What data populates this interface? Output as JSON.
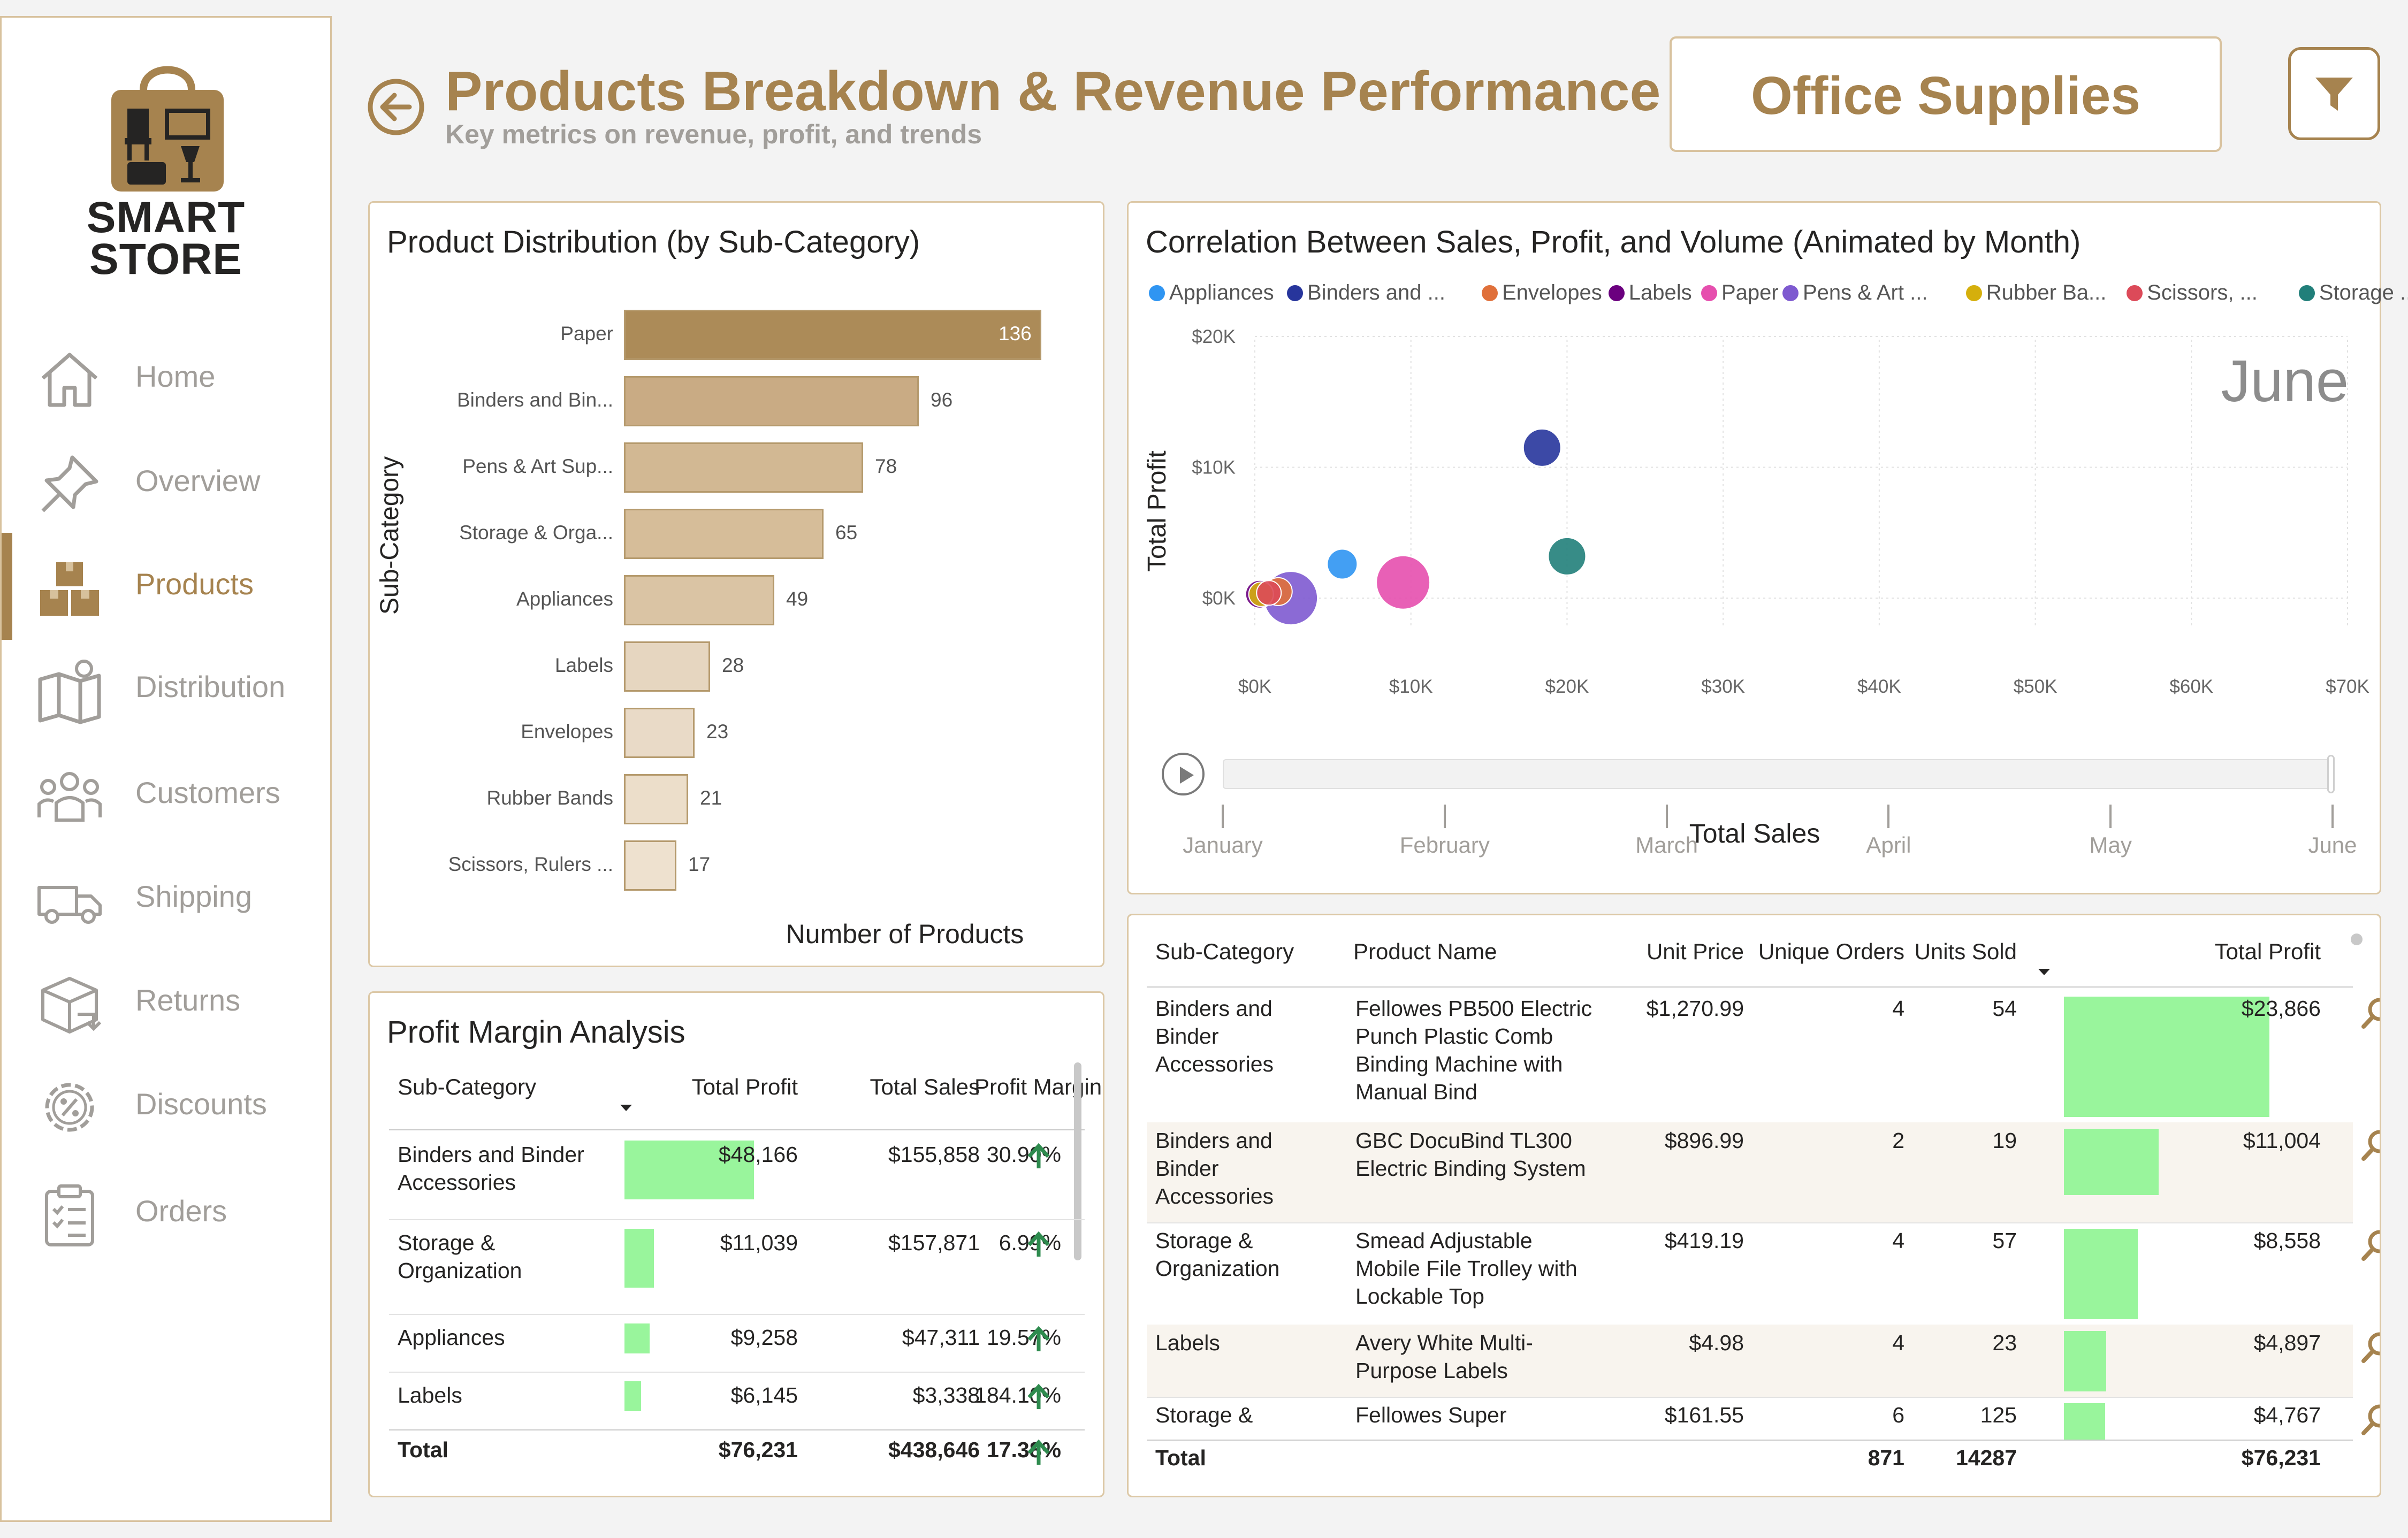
{
  "colors": {
    "accent": "#a6834f",
    "muted": "#a19e9a",
    "positive_bar": "#99f59c",
    "up_arrow": "#2e8b4e"
  },
  "sidebar": {
    "logo_lines": [
      "SMART",
      "STORE"
    ],
    "items": [
      {
        "label": "Home",
        "icon": "home-icon"
      },
      {
        "label": "Overview",
        "icon": "pin-icon"
      },
      {
        "label": "Products",
        "icon": "boxes-icon",
        "active": true
      },
      {
        "label": "Distribution",
        "icon": "map-icon"
      },
      {
        "label": "Customers",
        "icon": "people-icon"
      },
      {
        "label": "Shipping",
        "icon": "truck-icon"
      },
      {
        "label": "Returns",
        "icon": "return-box-icon"
      },
      {
        "label": "Discounts",
        "icon": "discount-gear-icon"
      },
      {
        "label": "Orders",
        "icon": "clipboard-icon"
      }
    ]
  },
  "header": {
    "title": "Products Breakdown & Revenue Performance",
    "subtitle": "Key metrics on revenue, profit, and trends",
    "category": "Office Supplies"
  },
  "product_distribution": {
    "title": "Product Distribution (by Sub-Category)",
    "ylabel": "Sub-Category",
    "xlabel": "Number of Products"
  },
  "chart_data": [
    {
      "type": "bar",
      "orientation": "horizontal",
      "title": "Product Distribution (by Sub-Category)",
      "xlabel": "Number of Products",
      "ylabel": "Sub-Category",
      "categories": [
        "Paper",
        "Binders and Bin...",
        "Pens & Art Sup...",
        "Storage & Orga...",
        "Appliances",
        "Labels",
        "Envelopes",
        "Rubber Bands",
        "Scissors, Rulers ..."
      ],
      "values": [
        136,
        96,
        78,
        65,
        49,
        28,
        23,
        21,
        17
      ],
      "colors": [
        "#ac8b58",
        "#c9ab84",
        "#d2b893",
        "#d6bd99",
        "#dac4a4",
        "#e6d6c0",
        "#e9dac7",
        "#ecdeca",
        "#eee1cf"
      ],
      "data_labels": true
    },
    {
      "type": "scatter",
      "title": "Correlation Between Sales, Profit, and Volume (Animated by Month)",
      "xlabel": "Total Sales",
      "ylabel": "Total Profit",
      "frame_label": "June",
      "x_ticks": [
        "$0K",
        "$10K",
        "$20K",
        "$30K",
        "$40K",
        "$50K",
        "$60K",
        "$70K"
      ],
      "y_ticks": [
        "$20K",
        "$10K",
        "$0K"
      ],
      "xlim": [
        0,
        70000
      ],
      "ylim": [
        -2000,
        20000
      ],
      "grid": true,
      "legend_position": "top",
      "series": [
        {
          "name": "Appliances",
          "color": "#2f95f2",
          "points": [
            {
              "x": 5600,
              "y": 2600,
              "size": 1
            }
          ]
        },
        {
          "name": "Binders and ...",
          "color": "#27359c",
          "points": [
            {
              "x": 18400,
              "y": 11500,
              "size": 1.3
            }
          ]
        },
        {
          "name": "Envelopes",
          "color": "#e0703a",
          "points": [
            {
              "x": 1500,
              "y": 500,
              "size": 0.9
            }
          ]
        },
        {
          "name": "Labels",
          "color": "#6b007f",
          "points": [
            {
              "x": 300,
              "y": 300,
              "size": 0.9
            }
          ]
        },
        {
          "name": "Paper",
          "color": "#e64fae",
          "points": [
            {
              "x": 9500,
              "y": 1200,
              "size": 1.9
            }
          ]
        },
        {
          "name": "Pens & Art ...",
          "color": "#7e5ad0",
          "points": [
            {
              "x": 2300,
              "y": 0,
              "size": 1.9
            }
          ]
        },
        {
          "name": "Rubber Ba...",
          "color": "#d5af0c",
          "points": [
            {
              "x": 400,
              "y": 300,
              "size": 0.8
            }
          ]
        },
        {
          "name": "Scissors, ...",
          "color": "#dc4a59",
          "points": [
            {
              "x": 900,
              "y": 400,
              "size": 0.8
            }
          ]
        },
        {
          "name": "Storage ...",
          "color": "#217f7a",
          "points": [
            {
              "x": 20000,
              "y": 3200,
              "size": 1.3
            }
          ]
        }
      ]
    }
  ],
  "timeline": {
    "months": [
      "January",
      "February",
      "March",
      "April",
      "May",
      "June"
    ],
    "current": "June",
    "progress": 1.0
  },
  "profit_margin": {
    "title": "Profit Margin Analysis",
    "columns": [
      "Sub-Category",
      "Total Profit",
      "Total Sales",
      "Profit Margin"
    ],
    "rows": [
      {
        "sub": "Binders and Binder Accessories",
        "sub_lines": [
          "Binders and Binder",
          "Accessories"
        ],
        "profit": "$48,166",
        "profit_value": 48166,
        "sales": "$155,858",
        "margin": "30.90%"
      },
      {
        "sub": "Storage & Organization",
        "sub_lines": [
          "Storage &",
          "Organization"
        ],
        "profit": "$11,039",
        "profit_value": 11039,
        "sales": "$157,871",
        "margin": "6.99%"
      },
      {
        "sub": "Appliances",
        "sub_lines": [
          "Appliances"
        ],
        "profit": "$9,258",
        "profit_value": 9258,
        "sales": "$47,311",
        "margin": "19.57%"
      },
      {
        "sub": "Labels",
        "sub_lines": [
          "Labels"
        ],
        "profit": "$6,145",
        "profit_value": 6145,
        "sales": "$3,338",
        "margin": "184.10%"
      }
    ],
    "total": {
      "label": "Total",
      "profit": "$76,231",
      "sales": "$438,646",
      "margin": "17.38%"
    }
  },
  "product_table": {
    "columns": [
      "Sub-Category",
      "Product Name",
      "Unit Price",
      "Unique Orders",
      "Units Sold",
      "Total Profit"
    ],
    "rows": [
      {
        "sub_lines": [
          "Binders and",
          "Binder",
          "Accessories"
        ],
        "name_lines": [
          "Fellowes PB500 Electric",
          "Punch Plastic Comb",
          "Binding Machine with",
          "Manual Bind"
        ],
        "price": "$1,270.99",
        "orders": "4",
        "units": "54",
        "profit": "$23,866",
        "profit_value": 23866
      },
      {
        "sub_lines": [
          "Binders and",
          "Binder",
          "Accessories"
        ],
        "name_lines": [
          "GBC DocuBind TL300",
          "Electric Binding System"
        ],
        "price": "$896.99",
        "orders": "2",
        "units": "19",
        "profit": "$11,004",
        "profit_value": 11004
      },
      {
        "sub_lines": [
          "Storage &",
          "Organization"
        ],
        "name_lines": [
          "Smead Adjustable",
          "Mobile File Trolley with",
          "Lockable Top"
        ],
        "price": "$419.19",
        "orders": "4",
        "units": "57",
        "profit": "$8,558",
        "profit_value": 8558
      },
      {
        "sub_lines": [
          "Labels"
        ],
        "name_lines": [
          "Avery White Multi-",
          "Purpose Labels"
        ],
        "price": "$4.98",
        "orders": "4",
        "units": "23",
        "profit": "$4,897",
        "profit_value": 4897
      },
      {
        "sub_lines": [
          "Storage &"
        ],
        "name_lines": [
          "Fellowes Super"
        ],
        "price": "$161.55",
        "orders": "6",
        "units": "125",
        "profit": "$4,767",
        "profit_value": 4767
      }
    ],
    "total": {
      "label": "Total",
      "orders": "871",
      "units": "14287",
      "profit": "$76,231"
    }
  }
}
